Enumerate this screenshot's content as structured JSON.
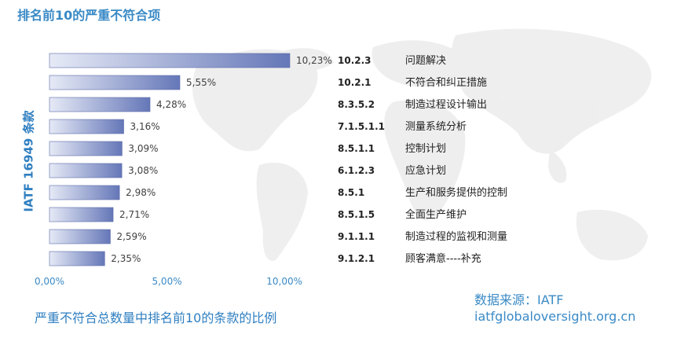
{
  "title": "排名前10的严重不符合项",
  "caption": "严重不符合总数量中排名前10的条款的比例",
  "source": {
    "label": "数据来源：IATF",
    "url": "iatfglobaloversight.org.cn"
  },
  "colors": {
    "accent": "#3a8ac6",
    "bar_light": "#e6eaf6",
    "bar_dark": "#6577b8"
  },
  "chart_data": {
    "type": "bar",
    "orientation": "horizontal",
    "ylabel": "IATF 16949 条款",
    "xlim": [
      0,
      10.23
    ],
    "xticks": [
      0,
      5,
      10
    ],
    "xtick_labels": [
      "0,00%",
      "5,00%",
      "10,00%"
    ],
    "grid": false,
    "legend": "none",
    "rows": [
      {
        "clause": "10.2.3",
        "desc": "问题解决",
        "value": 10.23,
        "label": "10,23%"
      },
      {
        "clause": "10.2.1",
        "desc": "不符合和纠正措施",
        "value": 5.55,
        "label": "5,55%"
      },
      {
        "clause": "8.3.5.2",
        "desc": "制造过程设计输出",
        "value": 4.28,
        "label": "4,28%"
      },
      {
        "clause": "7.1.5.1.1",
        "desc": "测量系统分析",
        "value": 3.16,
        "label": "3,16%"
      },
      {
        "clause": "8.5.1.1",
        "desc": "控制计划",
        "value": 3.09,
        "label": "3,09%"
      },
      {
        "clause": "6.1.2.3",
        "desc": "应急计划",
        "value": 3.08,
        "label": "3,08%"
      },
      {
        "clause": "8.5.1",
        "desc": "生产和服务提供的控制",
        "value": 2.98,
        "label": "2,98%"
      },
      {
        "clause": "8.5.1.5",
        "desc": "全面生产维护",
        "value": 2.71,
        "label": "2,71%"
      },
      {
        "clause": "9.1.1.1",
        "desc": "制造过程的监视和测量",
        "value": 2.59,
        "label": "2,59%"
      },
      {
        "clause": "9.1.2.1",
        "desc": "顾客满意----补充",
        "value": 2.35,
        "label": "2,35%"
      }
    ]
  }
}
